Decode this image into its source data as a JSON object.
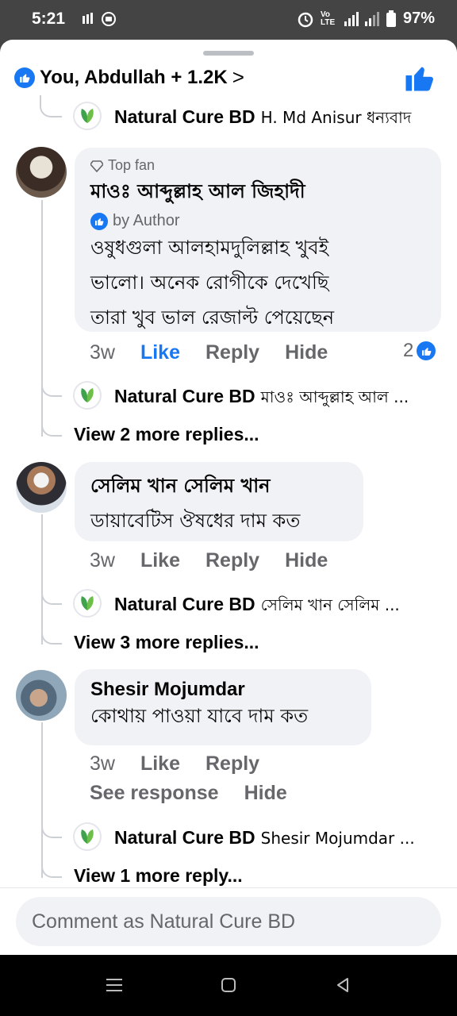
{
  "status_bar": {
    "time": "5:21",
    "network": "4G",
    "carrier": "Vo LTE",
    "battery": "97%"
  },
  "reactions": {
    "summary": "You, Abdullah + 1.2K",
    "chevron": ">"
  },
  "thread": [
    {
      "id": "pre_reply",
      "page": "Natural Cure BD",
      "text": "H. Md Anisur ধন্যবাদ"
    },
    {
      "id": "c1",
      "badge": "Top fan",
      "author": "মাওঃ আব্দুল্লাহ আল জিহাদী",
      "by_author": "by Author",
      "lines": [
        "ওষুধগুলা আলহামদুলিল্লাহ খুবই",
        "ভালো। অনেক রোগীকে দেখেছি",
        "তারা খুব ভাল রেজাল্ট পেয়েছেন"
      ],
      "time": "3w",
      "like": "Like",
      "reply": "Reply",
      "hide": "Hide",
      "react_count": "2",
      "reply_preview": {
        "page": "Natural Cure BD",
        "text": "মাওঃ আব্দুল্লাহ আল ..."
      },
      "view_more": "View 2 more replies..."
    },
    {
      "id": "c2",
      "author": "সেলিম খান সেলিম খান",
      "lines": [
        "ডায়াবেটিস ঔষধের দাম কত"
      ],
      "time": "3w",
      "like": "Like",
      "reply": "Reply",
      "hide": "Hide",
      "reply_preview": {
        "page": "Natural Cure BD",
        "text": "সেলিম খান সেলিম ..."
      },
      "view_more": "View 3 more replies..."
    },
    {
      "id": "c3",
      "author": "Shesir Mojumdar",
      "lines": [
        "কোথায় পাওয়া যাবে দাম কত"
      ],
      "time": "3w",
      "like": "Like",
      "reply": "Reply",
      "see_response": "See response",
      "hide": "Hide",
      "reply_preview": {
        "page": "Natural Cure BD",
        "text": "Shesir Mojumdar ..."
      },
      "view_more": "View 1 more reply..."
    }
  ],
  "composer": {
    "placeholder": "Comment as Natural Cure BD"
  },
  "colors": {
    "accent": "#1877f2",
    "bubble": "#f0f2f5",
    "muted": "#65676b"
  }
}
